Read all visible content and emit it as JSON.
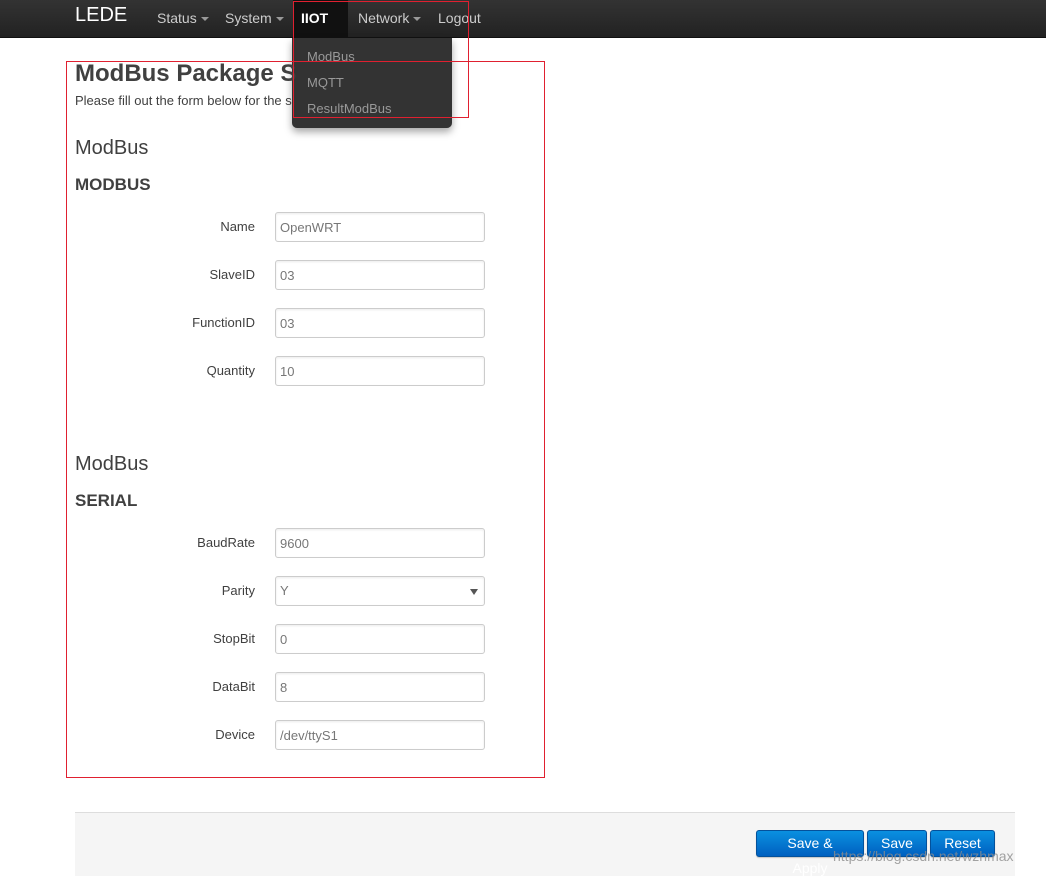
{
  "navbar": {
    "brand": "LEDE",
    "items": [
      {
        "label": "Status"
      },
      {
        "label": "System"
      },
      {
        "label": "IIOT"
      },
      {
        "label": "Network"
      },
      {
        "label": "Logout"
      }
    ],
    "dropdown": [
      "ModBus",
      "MQTT",
      "ResultModBus"
    ]
  },
  "page": {
    "title": "ModBus Package S",
    "description": "Please fill out the form below for the s"
  },
  "sections": [
    {
      "title": "ModBus",
      "subtitle": "MODBUS",
      "fields": [
        {
          "label": "Name",
          "value": "OpenWRT"
        },
        {
          "label": "SlaveID",
          "value": "03"
        },
        {
          "label": "FunctionID",
          "value": "03"
        },
        {
          "label": "Quantity",
          "value": "10"
        }
      ]
    },
    {
      "title": "ModBus",
      "subtitle": "SERIAL",
      "fields": [
        {
          "label": "BaudRate",
          "value": "9600"
        },
        {
          "label": "Parity",
          "value": "Y"
        },
        {
          "label": "StopBit",
          "value": "0"
        },
        {
          "label": "DataBit",
          "value": "8"
        },
        {
          "label": "Device",
          "value": "/dev/ttyS1"
        }
      ]
    }
  ],
  "buttons": {
    "save_apply": "Save & Apply",
    "save": "Save",
    "reset": "Reset"
  },
  "watermark": "https://blog.csdn.net/wzhmax",
  "colors": {
    "navbar": "#222222",
    "accent_button": "#0a7ad0",
    "highlight": "#e02030"
  }
}
